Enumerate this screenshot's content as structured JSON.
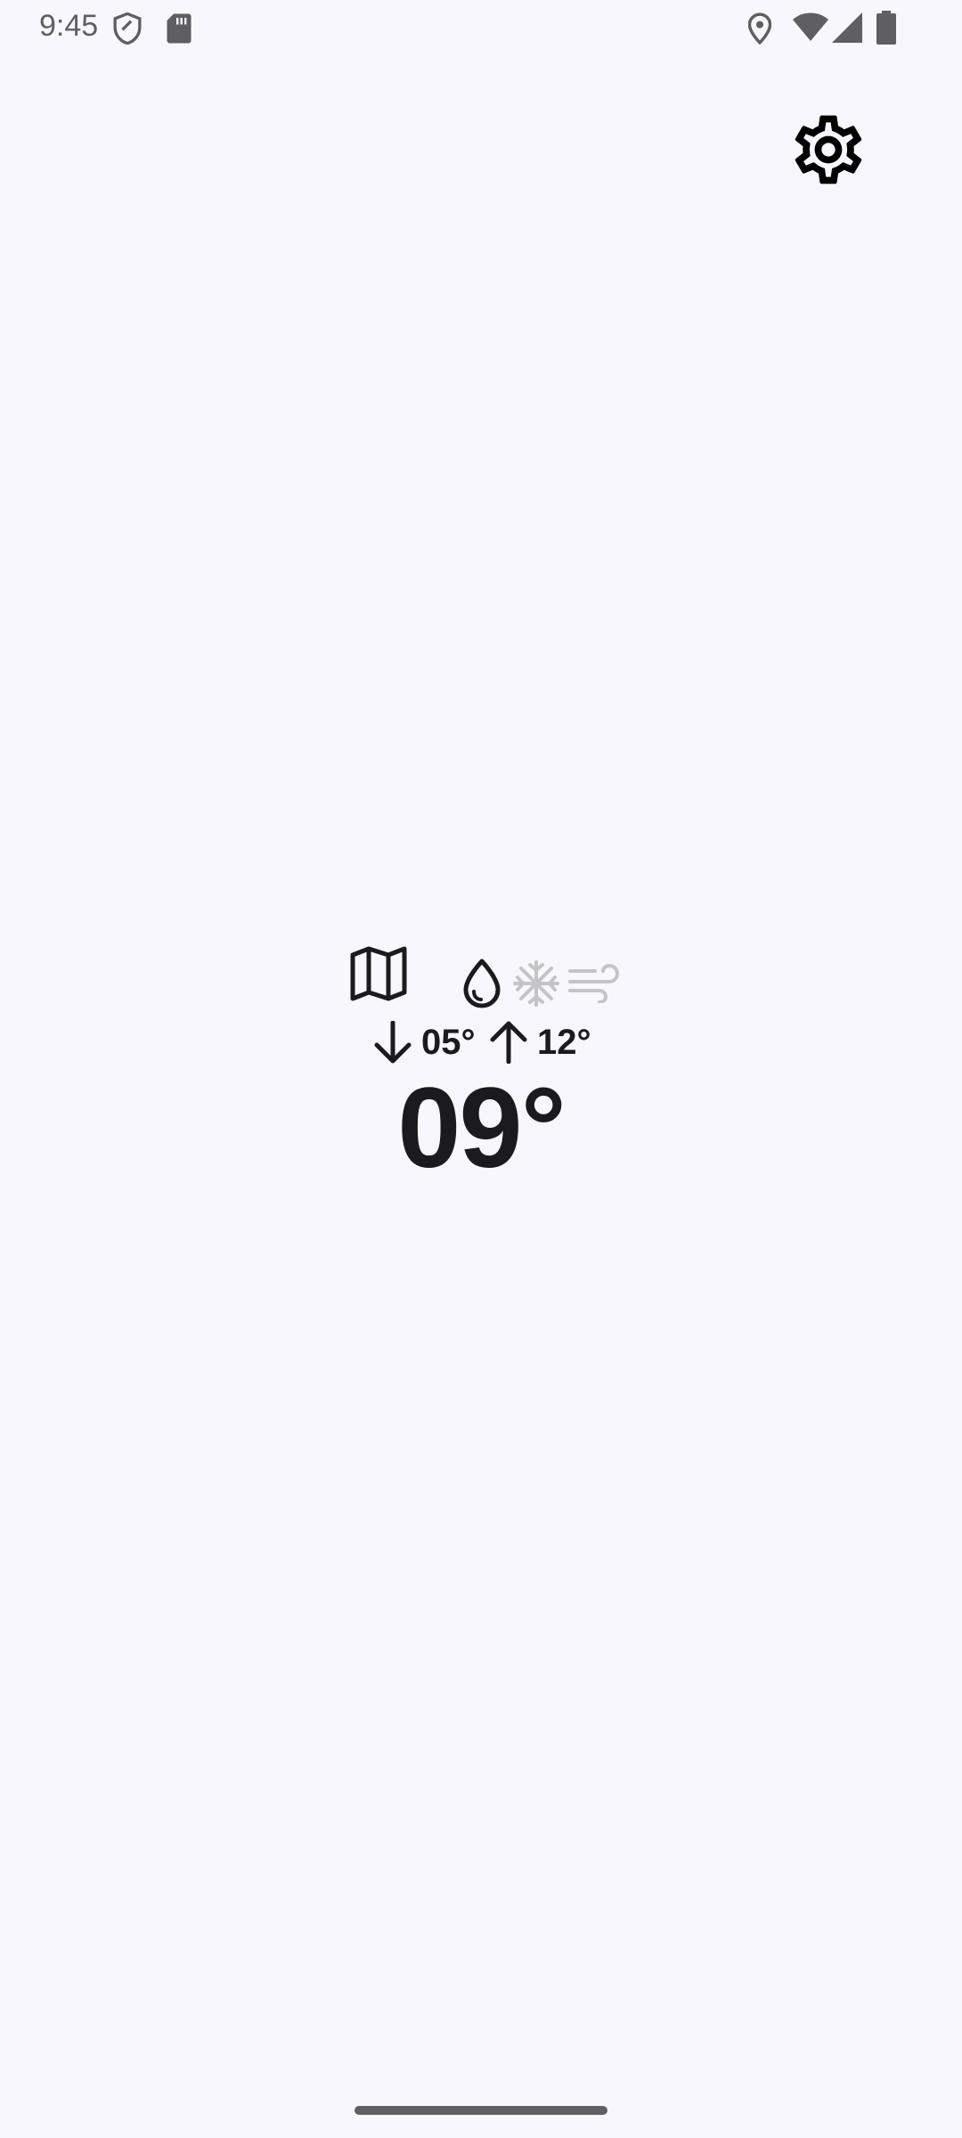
{
  "status_bar": {
    "time": "9:45",
    "icons": [
      "shield-icon",
      "sd-card-icon",
      "location-icon",
      "wifi-icon",
      "cellular-signal-icon",
      "battery-icon"
    ]
  },
  "toolbar": {
    "settings_icon": "gear-icon"
  },
  "weather": {
    "icons": [
      "map-icon",
      "water-drop-icon",
      "snowflake-icon",
      "wind-icon"
    ],
    "low_temp": "05°",
    "high_temp": "12°",
    "current_temp": "09°"
  },
  "colors": {
    "background": "#f8f7fd",
    "text": "#1b1b1f",
    "inactive_icon": "#c4c4c8"
  }
}
